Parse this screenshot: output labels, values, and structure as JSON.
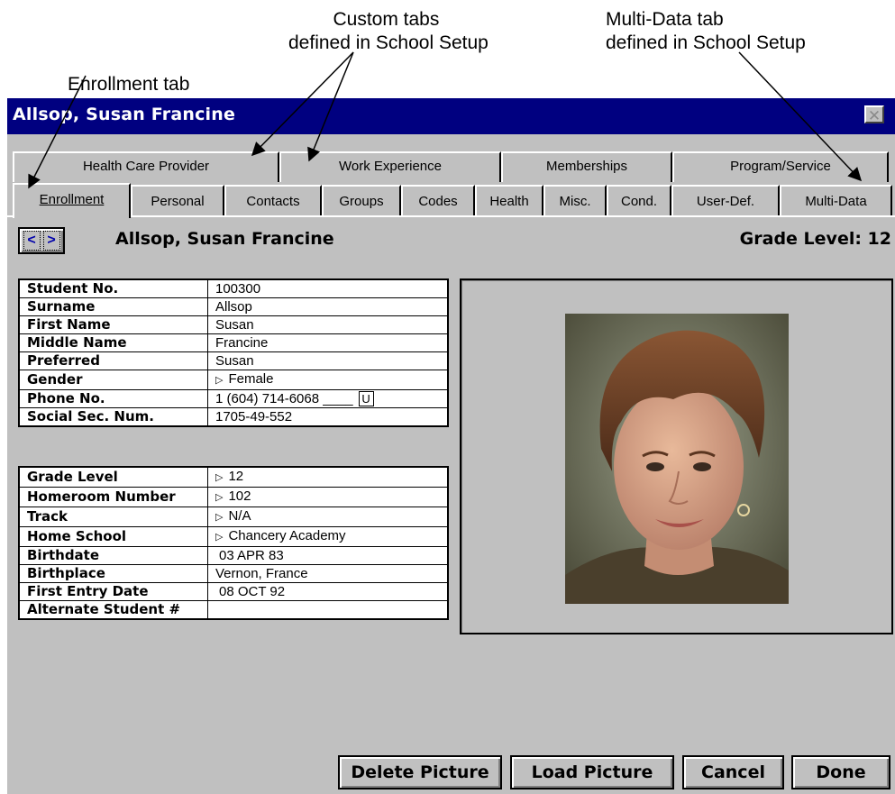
{
  "annotations": {
    "enrollment_tab": "Enrollment tab",
    "custom_tabs_line1": "Custom tabs",
    "custom_tabs_line2": "defined in School Setup",
    "multidata_tab_line1": "Multi-Data tab",
    "multidata_tab_line2": "defined in School Setup"
  },
  "window": {
    "title": "Allsop, Susan Francine",
    "close_glyph": "✕"
  },
  "tabs": {
    "row1": [
      "Health Care Provider",
      "Work Experience",
      "Memberships",
      "Program/Service"
    ],
    "row2": [
      "Enrollment",
      "Personal",
      "Contacts",
      "Groups",
      "Codes",
      "Health",
      "Misc.",
      "Cond.",
      "User-Def.",
      "Multi-Data"
    ],
    "active": "Enrollment"
  },
  "header": {
    "nav_prev": "<",
    "nav_next": ">",
    "student_name": "Allsop, Susan Francine",
    "grade_level": "Grade Level: 12"
  },
  "fields1": [
    {
      "label": "Student No.",
      "value": "100300"
    },
    {
      "label": "Surname",
      "value": "Allsop"
    },
    {
      "label": "First Name",
      "value": "Susan"
    },
    {
      "label": "Middle Name",
      "value": "Francine"
    },
    {
      "label": "Preferred",
      "value": "Susan"
    },
    {
      "label": "Gender",
      "value": "Female"
    },
    {
      "label": "Phone No.",
      "value": "1 (604) 714-6068 ____",
      "flag": "U"
    },
    {
      "label": "Social Sec. Num.",
      "value": "1705-49-552"
    }
  ],
  "fields2": [
    {
      "label": "Grade Level",
      "value": "12"
    },
    {
      "label": "Homeroom Number",
      "value": "102"
    },
    {
      "label": "Track",
      "value": "N/A"
    },
    {
      "label": "Home School",
      "value": "Chancery Academy"
    },
    {
      "label": "Birthdate",
      "value": "03 APR 83"
    },
    {
      "label": "Birthplace",
      "value": "Vernon, France"
    },
    {
      "label": "First Entry Date",
      "value": "08 OCT 92"
    },
    {
      "label": "Alternate Student #",
      "value": ""
    }
  ],
  "buttons": {
    "delete_picture": "Delete Picture",
    "load_picture": "Load Picture",
    "cancel": "Cancel",
    "done": "Done"
  }
}
